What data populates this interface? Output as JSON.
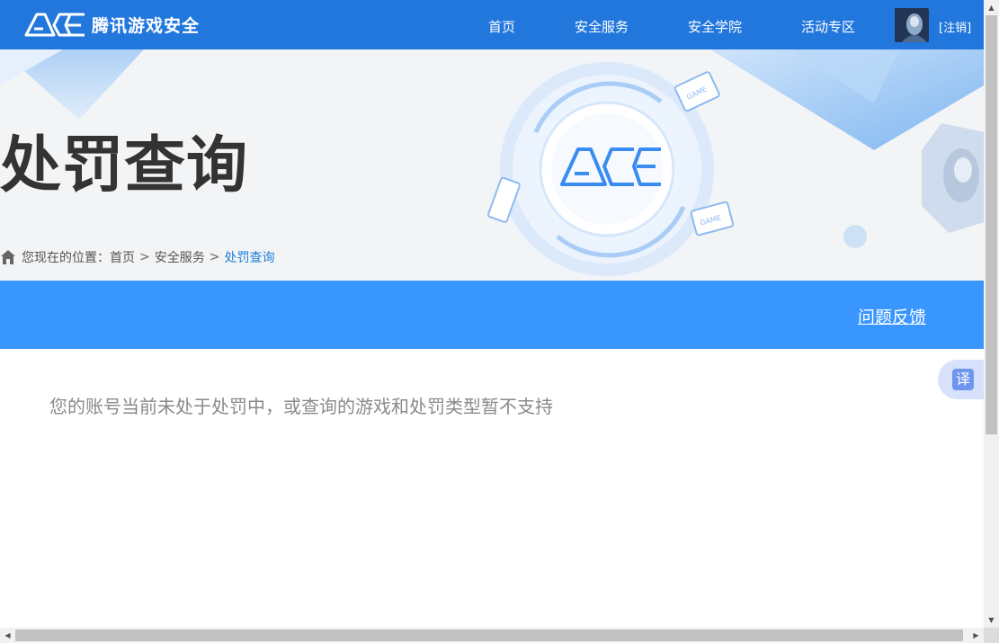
{
  "header": {
    "logo_text": "腾讯游戏安全",
    "nav": [
      {
        "label": "首页"
      },
      {
        "label": "安全服务"
      },
      {
        "label": "安全学院"
      },
      {
        "label": "活动专区"
      }
    ],
    "logout_label": "[注销]"
  },
  "hero": {
    "title": "处罚查询",
    "breadcrumb": {
      "prefix": "您现在的位置：",
      "items": [
        "首页",
        "安全服务",
        "处罚查询"
      ],
      "separator": ">"
    }
  },
  "feedback_label": "问题反馈",
  "message": "您的账号当前未处于处罚中，或查询的游戏和处罚类型暂不支持",
  "translate_label": "译",
  "colors": {
    "header_bg": "#2277dd",
    "bar_bg": "#3a96ff",
    "breadcrumb_current": "#1e7fd8",
    "title": "#333333"
  }
}
